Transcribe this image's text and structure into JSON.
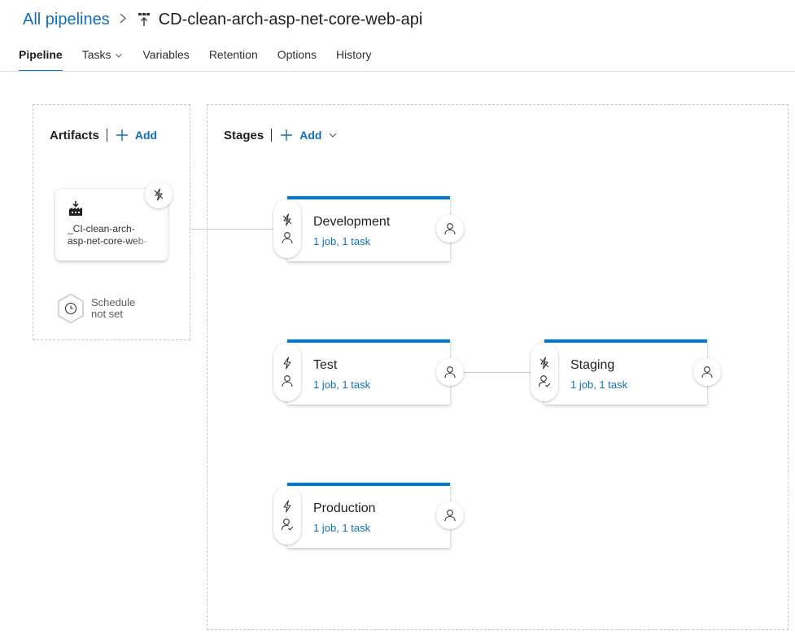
{
  "breadcrumb": {
    "root_label": "All pipelines",
    "pipeline_title": "CD-clean-arch-asp-net-core-web-api"
  },
  "tabs": [
    {
      "label": "Pipeline",
      "active": true
    },
    {
      "label": "Tasks",
      "active": false
    },
    {
      "label": "Variables",
      "active": false
    },
    {
      "label": "Retention",
      "active": false
    },
    {
      "label": "Options",
      "active": false
    },
    {
      "label": "History",
      "active": false
    }
  ],
  "artifacts": {
    "title": "Artifacts",
    "add_label": "Add",
    "artifact_name_line1": "_CI-clean-arch-",
    "artifact_name_line2": "asp-net-core-web-",
    "schedule_line1": "Schedule",
    "schedule_line2": "not set"
  },
  "stages": {
    "title": "Stages",
    "add_label": "Add",
    "items": [
      {
        "name": "Development",
        "meta": "1 job, 1 task"
      },
      {
        "name": "Test",
        "meta": "1 job, 1 task"
      },
      {
        "name": "Staging",
        "meta": "1 job, 1 task"
      },
      {
        "name": "Production",
        "meta": "1 job, 1 task"
      }
    ]
  },
  "colors": {
    "accent": "#0078d4",
    "link": "#106ebe",
    "border": "#c8c6c4"
  }
}
